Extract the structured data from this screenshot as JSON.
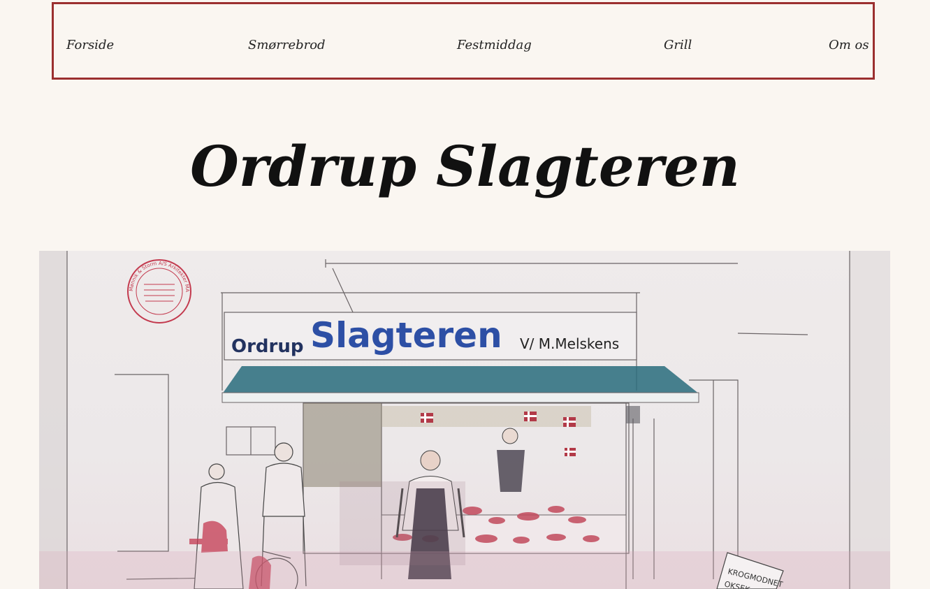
{
  "nav": {
    "items": [
      {
        "label": "Forside"
      },
      {
        "label": "Smørrebrod"
      },
      {
        "label": "Festmiddag"
      },
      {
        "label": "Grill"
      },
      {
        "label": "Om os"
      }
    ]
  },
  "page": {
    "title": "Ordrup Slagteren"
  },
  "hero": {
    "sign_main": "Slagteren",
    "sign_left": "Ordrup",
    "sign_right": "V/ M.Melskens",
    "stamp_text": "Mønnik & Storm A/S Arkitekter MAA",
    "board_text_1": "KROGMODNET",
    "board_text_2": "OKSEK..."
  },
  "colors": {
    "accent": "#9b2f2f",
    "background": "#faf6f1",
    "sign_blue": "#2d4fa5",
    "awning": "#2f6f80"
  }
}
